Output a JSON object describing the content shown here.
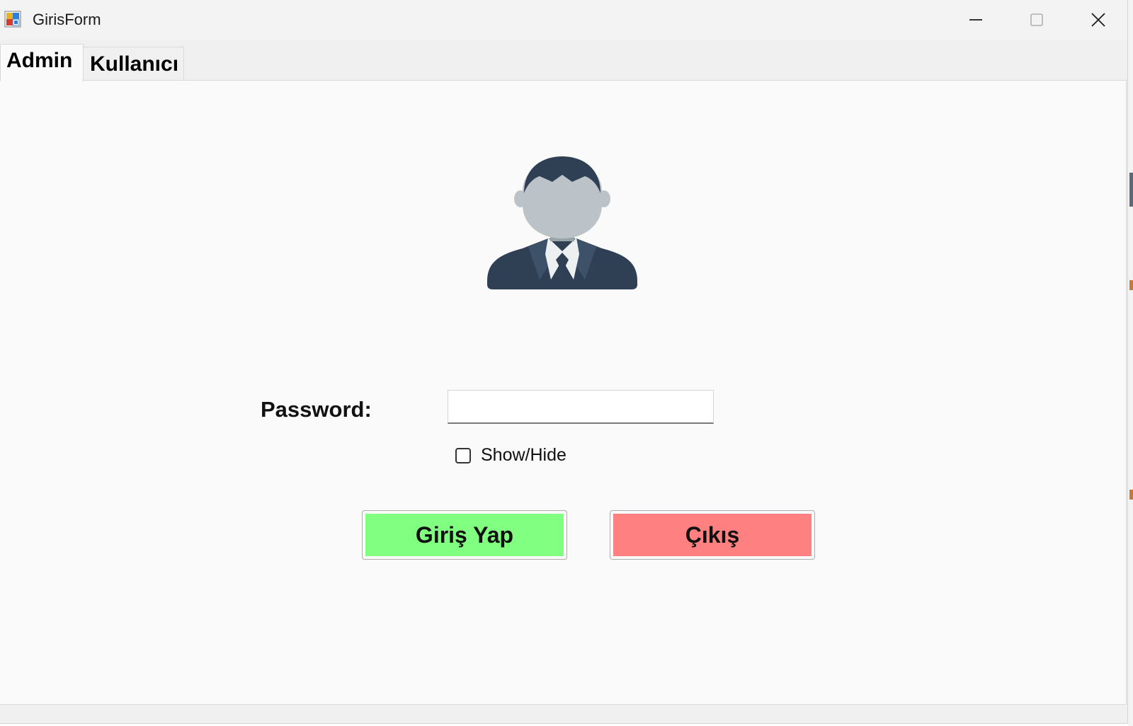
{
  "window": {
    "title": "GirisForm",
    "app_icon": "winforms-app-icon",
    "controls": {
      "minimize_icon": "minimize-icon",
      "maximize_icon": "maximize-icon",
      "close_icon": "close-icon"
    }
  },
  "tabs": [
    {
      "label": "Admin",
      "selected": true
    },
    {
      "label": "Kullanıcı",
      "selected": false
    }
  ],
  "login": {
    "avatar_icon": "user-avatar-icon",
    "password_label": "Password:",
    "password_value": "",
    "show_hide_label": "Show/Hide",
    "show_hide_checked": false,
    "login_button": "Giriş Yap",
    "exit_button": "Çıkış"
  },
  "colors": {
    "login_button_bg": "#80ff80",
    "exit_button_bg": "#ff8080",
    "avatar_suit": "#2f4054",
    "avatar_skin": "#bcc3c8"
  }
}
